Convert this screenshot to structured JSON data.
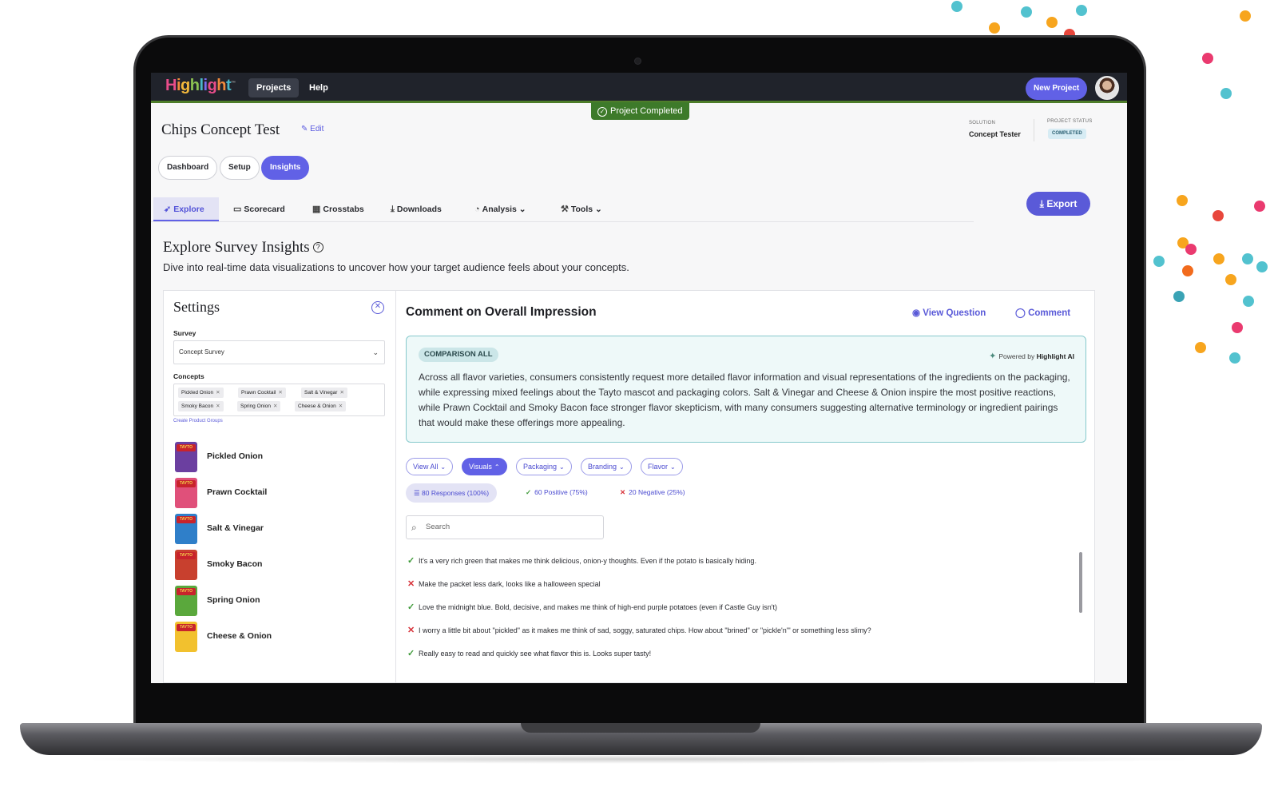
{
  "topbar": {
    "logo_text": "Highlight",
    "nav": [
      "Projects",
      "Help"
    ],
    "new_project": "New Project",
    "avatar_icon": "user-avatar"
  },
  "status_banner": "Project Completed",
  "project": {
    "title": "Chips Concept Test",
    "edit_label": "Edit",
    "solution_label": "SOLUTION",
    "solution_value": "Concept Tester",
    "status_label": "PROJECT STATUS",
    "status_value": "COMPLETED"
  },
  "pill_tabs": [
    "Dashboard",
    "Setup",
    "Insights"
  ],
  "sub_tabs": [
    "Explore",
    "Scorecard",
    "Crosstabs",
    "Downloads",
    "Analysis",
    "Tools"
  ],
  "export_label": "Export",
  "explore": {
    "heading": "Explore Survey Insights",
    "subheading": "Dive into real-time data visualizations to uncover how your target audience feels about your concepts."
  },
  "settings": {
    "heading": "Settings",
    "survey_label": "Survey",
    "survey_value": "Concept Survey",
    "concepts_label": "Concepts",
    "concept_chips": [
      "Pickled Onion",
      "Prawn Cocktail",
      "Salt & Vinegar",
      "Smoky Bacon",
      "Spring Onion",
      "Cheese & Onion"
    ],
    "create_groups": "Create Product Groups",
    "products": [
      {
        "name": "Pickled Onion",
        "color": "#6b3fa0"
      },
      {
        "name": "Prawn Cocktail",
        "color": "#e0507a"
      },
      {
        "name": "Salt & Vinegar",
        "color": "#2f7fc9"
      },
      {
        "name": "Smoky Bacon",
        "color": "#c8402e"
      },
      {
        "name": "Spring Onion",
        "color": "#5aa83c"
      },
      {
        "name": "Cheese & Onion",
        "color": "#f2c12e"
      }
    ]
  },
  "question": {
    "title": "Comment on Overall Impression",
    "view_question": "View Question",
    "comment": "Comment"
  },
  "ai_summary": {
    "badge": "COMPARISON ALL",
    "powered_prefix": "Powered by",
    "powered_brand": "Highlight AI",
    "text": "Across all flavor varieties, consumers consistently request more detailed flavor information and visual representations of the ingredients on the packaging, while expressing mixed feelings about the Tayto mascot and packaging colors. Salt & Vinegar and Cheese & Onion inspire the most positive reactions, while Prawn Cocktail and Smoky Bacon face stronger flavor skepticism, with many consumers suggesting alternative terminology or ingredient pairings that would make these offerings more appealing."
  },
  "filters": [
    "View All",
    "Visuals",
    "Packaging",
    "Branding",
    "Flavor"
  ],
  "response_stats": {
    "total": "80 Responses (100%)",
    "positive": "60 Positive (75%)",
    "negative": "20 Negative (25%)"
  },
  "search_placeholder": "Search",
  "responses": [
    {
      "sentiment": "positive",
      "text": "It's a very rich green that makes me think delicious, onion-y thoughts. Even if the potato is basically hiding."
    },
    {
      "sentiment": "negative",
      "text": "Make the packet less dark, looks like a halloween special"
    },
    {
      "sentiment": "positive",
      "text": "Love the midnight blue. Bold, decisive, and makes me think of high-end purple potatoes (even if Castle Guy isn't)"
    },
    {
      "sentiment": "negative",
      "text": "I worry a little bit about \"pickled\" as it makes me think of sad, soggy, saturated chips. How about \"brined\" or \"pickle'n'\" or something less slimy?"
    },
    {
      "sentiment": "positive",
      "text": "Really easy to read and quickly see what flavor this is. Looks super tasty!"
    }
  ],
  "pack_brand": "TAYTO",
  "colors": {
    "accent": "#6161e6",
    "topbar": "#20232b",
    "status_green": "#3d7a2a",
    "ai_border": "#86c9cc"
  }
}
